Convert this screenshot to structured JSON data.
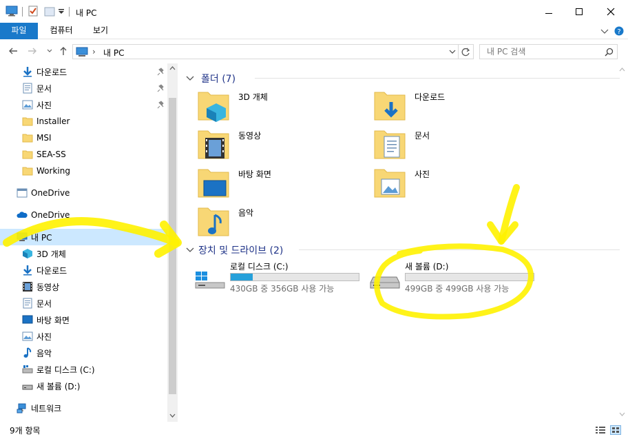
{
  "window": {
    "title": "내 PC"
  },
  "ribbon": {
    "tabs": [
      "파일",
      "컴퓨터",
      "보기"
    ]
  },
  "address": {
    "path": "내 PC",
    "search_placeholder": "내 PC 검색"
  },
  "nav": {
    "quick": [
      {
        "label": "다운로드",
        "icon": "download-icon",
        "pinned": true
      },
      {
        "label": "문서",
        "icon": "document-icon",
        "pinned": true
      },
      {
        "label": "사진",
        "icon": "picture-icon",
        "pinned": true
      },
      {
        "label": "Installer",
        "icon": "folder-icon",
        "pinned": false
      },
      {
        "label": "MSI",
        "icon": "folder-icon",
        "pinned": false
      },
      {
        "label": "SEA-SS",
        "icon": "folder-icon",
        "pinned": false
      },
      {
        "label": "Working",
        "icon": "folder-icon",
        "pinned": false
      }
    ],
    "onedrive1": "OneDrive",
    "onedrive2": "OneDrive",
    "thispc": "내 PC",
    "pc_items": [
      {
        "label": "3D 개체",
        "icon": "3d-objects-icon"
      },
      {
        "label": "다운로드",
        "icon": "download-icon"
      },
      {
        "label": "동영상",
        "icon": "video-icon"
      },
      {
        "label": "문서",
        "icon": "document-icon"
      },
      {
        "label": "바탕 화면",
        "icon": "desktop-icon"
      },
      {
        "label": "사진",
        "icon": "picture-icon"
      },
      {
        "label": "음악",
        "icon": "music-icon"
      },
      {
        "label": "로컬 디스크 (C:)",
        "icon": "drive-icon"
      },
      {
        "label": "새 볼륨 (D:)",
        "icon": "drive-icon"
      }
    ],
    "network": "네트워크"
  },
  "content": {
    "folders_header": "폴더 (7)",
    "folders": [
      {
        "label": "3D 개체",
        "icon": "3d-objects-icon"
      },
      {
        "label": "다운로드",
        "icon": "download-icon"
      },
      {
        "label": "동영상",
        "icon": "video-icon"
      },
      {
        "label": "문서",
        "icon": "document-icon"
      },
      {
        "label": "바탕 화면",
        "icon": "desktop-icon"
      },
      {
        "label": "사진",
        "icon": "picture-icon"
      },
      {
        "label": "음악",
        "icon": "music-icon"
      }
    ],
    "drives_header": "장치 및 드라이브 (2)",
    "drives": [
      {
        "label": "로컬 디스크 (C:)",
        "sub": "430GB 중 356GB 사용 가능",
        "used_fraction": 0.172
      },
      {
        "label": "새 볼륨 (D:)",
        "sub": "499GB 중 499GB 사용 가능",
        "used_fraction": 0.0
      }
    ]
  },
  "status": {
    "count": "9개 항목"
  },
  "colors": {
    "accent": "#1979ca",
    "selection": "#cce8ff",
    "header": "#1e3287",
    "highlighter": "#fff200",
    "drive_fill": "#26a0da"
  }
}
